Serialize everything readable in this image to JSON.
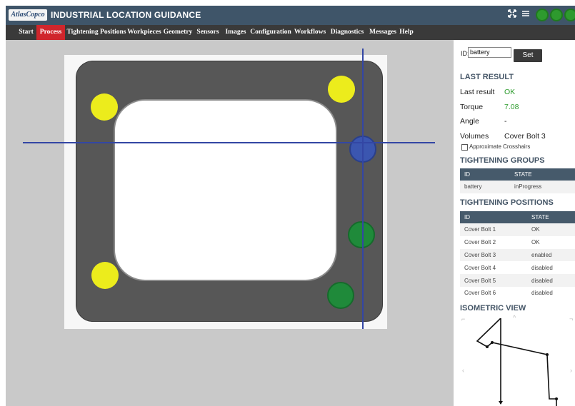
{
  "titlebar": {
    "logo_text": "AtlasCopco",
    "title": "INDUSTRIAL LOCATION GUIDANCE",
    "icons": [
      "expand-icon",
      "menu-icon"
    ],
    "status_color": "#2e9a2e"
  },
  "nav": {
    "items": [
      "Start",
      "Process",
      "Tightening Positions",
      "Workpieces",
      "Geometry",
      "Sensors",
      "Images",
      "Configuration",
      "Workflows",
      "Diagnostics",
      "Messages",
      "Help"
    ],
    "active": "Process",
    "active_color": "#d0262c"
  },
  "panel": {
    "id_label": "ID:",
    "id_value": "battery",
    "set_label": "Set",
    "last_result_header": "LAST RESULT",
    "last_result_key": "Last result",
    "last_result_value": "OK",
    "torque_key": "Torque",
    "torque_value": "7.08",
    "angle_key": "Angle",
    "angle_value": "-",
    "volumes_key": "Volumes",
    "volumes_value": "Cover Bolt 3",
    "crosshair_label": "Approximate Crosshairs",
    "groups_header": "TIGHTENING GROUPS",
    "groups_cols": [
      "ID",
      "STATE"
    ],
    "groups_rows": [
      [
        "battery",
        "inProgress"
      ]
    ],
    "positions_header": "TIGHTENING POSITIONS",
    "positions_cols": [
      "ID",
      "STATE"
    ],
    "positions_rows": [
      [
        "Cover Bolt 1",
        "OK"
      ],
      [
        "Cover Bolt 2",
        "OK"
      ],
      [
        "Cover Bolt 3",
        "enabled"
      ],
      [
        "Cover Bolt 4",
        "disabled"
      ],
      [
        "Cover Bolt 5",
        "disabled"
      ],
      [
        "Cover Bolt 6",
        "disabled"
      ]
    ],
    "iso_header": "ISOMETRIC VIEW"
  },
  "colors": {
    "bolt_ok": "#ecec1c",
    "bolt_active": "#3b56b0",
    "bolt_pending": "#1f8a3a",
    "crosshair": "#3346a4"
  }
}
